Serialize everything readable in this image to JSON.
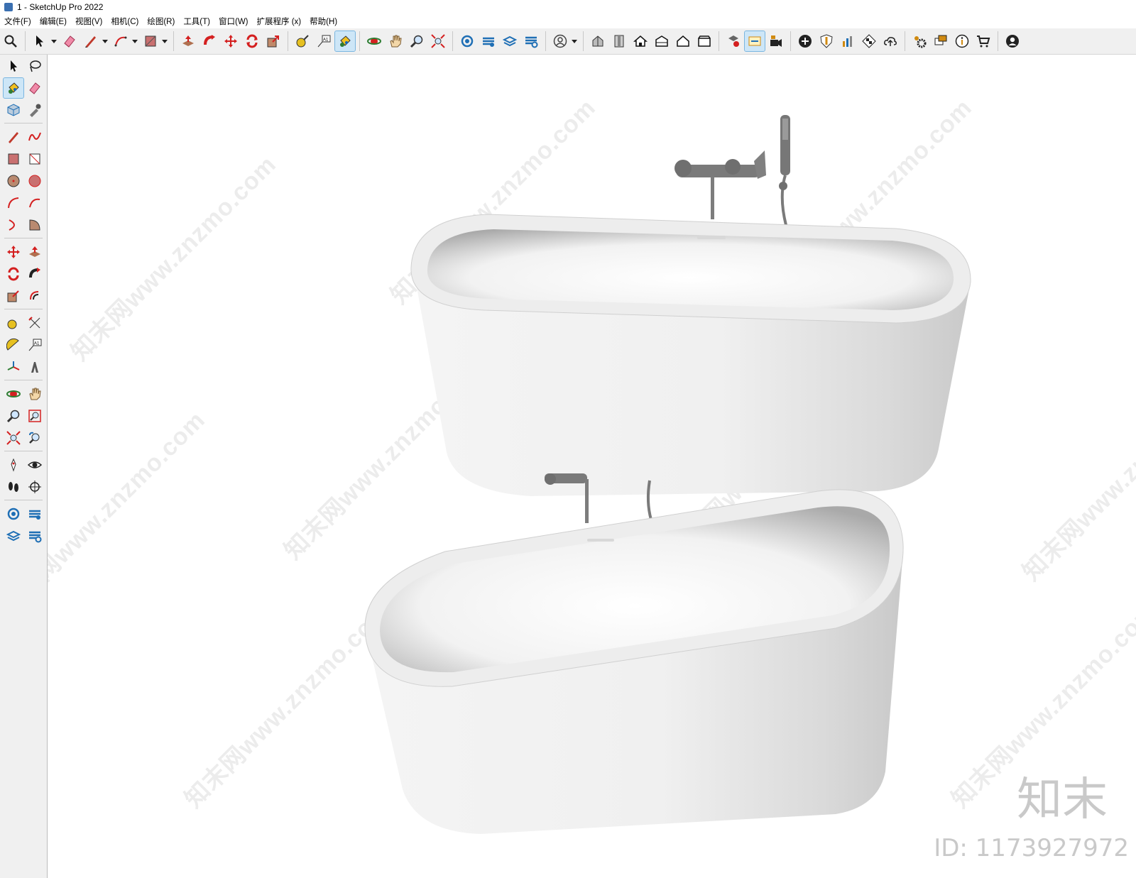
{
  "window": {
    "title": "1 - SketchUp Pro 2022"
  },
  "menu": {
    "items": [
      {
        "label": "文件(F)"
      },
      {
        "label": "编辑(E)"
      },
      {
        "label": "视图(V)"
      },
      {
        "label": "相机(C)"
      },
      {
        "label": "绘图(R)"
      },
      {
        "label": "工具(T)"
      },
      {
        "label": "窗口(W)"
      },
      {
        "label": "扩展程序 (x)"
      },
      {
        "label": "帮助(H)"
      }
    ]
  },
  "toolbar": {
    "active_tool": "paint-bucket-icon",
    "label_tool_text": "A1"
  },
  "colors": {
    "accent_red": "#d42020",
    "accent_blue": "#1f6fb5",
    "active_highlight": "#cde6f7",
    "fixture_gray": "#7a7a7a",
    "tub_white": "#f2f2f2"
  },
  "watermark": {
    "repeat_text": "知末网www.znzmo.com",
    "brand": "知末",
    "id_text": "ID: 1173927972"
  }
}
